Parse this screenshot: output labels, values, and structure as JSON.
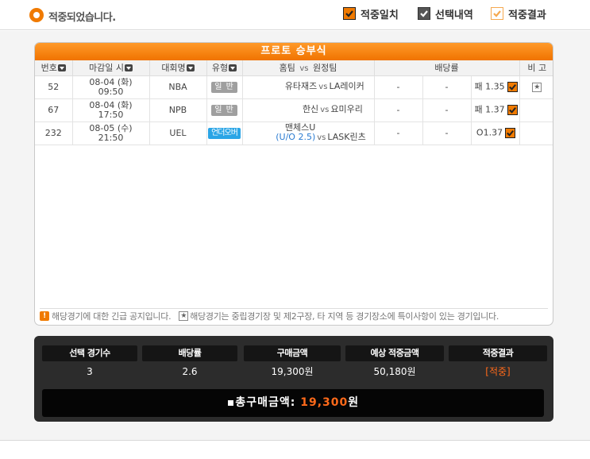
{
  "header": {
    "title": "적중되었습니다."
  },
  "legend": [
    {
      "label": "적중일치",
      "color": "#f07a00"
    },
    {
      "label": "선택내역",
      "color": "#555555"
    },
    {
      "label": "적중결과",
      "color": "#f5a84f"
    }
  ],
  "panel": {
    "title": "프로토 승부식",
    "columns": {
      "no": "번호",
      "deadline": "마감일 시",
      "league": "대회명",
      "type": "유형",
      "match_home": "홈팀",
      "match_vs": "vs",
      "match_away": "원정팀",
      "odds": "배당률",
      "note": "비 고"
    },
    "rows": [
      {
        "no": "52",
        "date": "08-04 (화)",
        "time": "09:50",
        "league": "NBA",
        "type": "일 반",
        "home": "유타재즈",
        "home_sub": "",
        "vs": "vs",
        "away": "LA레이커",
        "odd1": "-",
        "odd2": "-",
        "pick": "패 1.35",
        "note": "★"
      },
      {
        "no": "67",
        "date": "08-04 (화)",
        "time": "17:50",
        "league": "NPB",
        "type": "일 반",
        "home": "한신",
        "home_sub": "",
        "vs": "vs",
        "away": "요미우리",
        "odd1": "-",
        "odd2": "-",
        "pick": "패 1.37",
        "note": ""
      },
      {
        "no": "232",
        "date": "08-05 (수)",
        "time": "21:50",
        "league": "UEL",
        "type": "언더오버",
        "home": "맨체스U",
        "home_sub": "(U/O 2.5)",
        "vs": "vs",
        "away": "LASK린츠",
        "odd1": "-",
        "odd2": "-",
        "pick": "O1.37",
        "note": ""
      }
    ],
    "notice_urgent": "해당경기에 대한 긴급 공지입니다.",
    "notice_star_icon": "★",
    "notice_star": "해당경기는 중립경기장 및 제2구장, 타 지역 등 경기장소에 특이사항이 있는 경기입니다."
  },
  "summary": {
    "games_label": "선택 경기수",
    "games_value": "3",
    "odds_label": "배당률",
    "odds_value": "2.6",
    "purchase_label": "구매금액",
    "purchase_value": "19,300원",
    "expected_label": "예상 적중금액",
    "expected_value": "50,180원",
    "result_label": "적중결과",
    "result_value": "[적중]",
    "total_label": "▪총구매금액:",
    "total_amount": "19,300",
    "total_unit": "원"
  }
}
